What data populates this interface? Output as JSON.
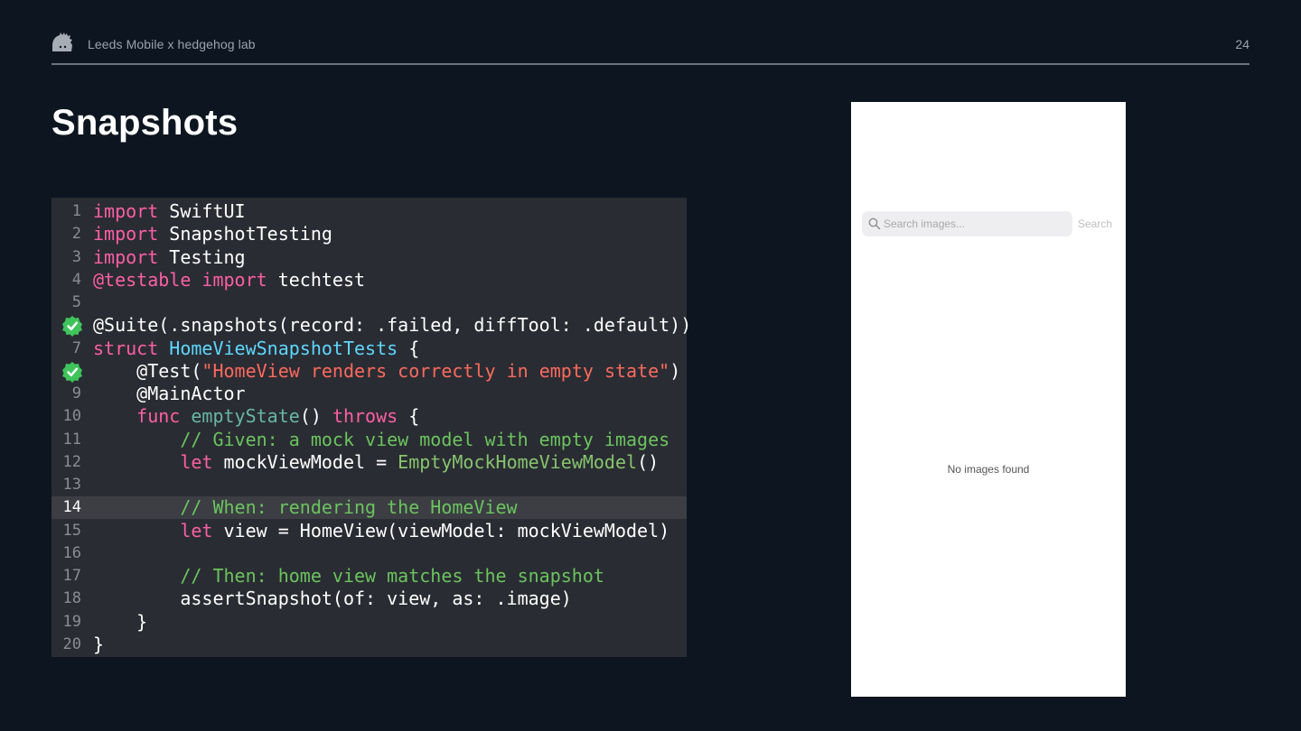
{
  "header": {
    "logo_icon": "hedgehog-icon",
    "text": "Leeds Mobile x hedgehog lab",
    "page_number": "24"
  },
  "slide": {
    "title": "Snapshots"
  },
  "code": {
    "active_line": 14,
    "badge_icon": "test-passed-checkmark-icon",
    "lines": [
      {
        "num": "1",
        "parts": [
          {
            "t": "import",
            "c": "kw"
          },
          {
            "t": " SwiftUI",
            "c": ""
          }
        ]
      },
      {
        "num": "2",
        "parts": [
          {
            "t": "import",
            "c": "kw"
          },
          {
            "t": " SnapshotTesting",
            "c": ""
          }
        ]
      },
      {
        "num": "3",
        "parts": [
          {
            "t": "import",
            "c": "kw"
          },
          {
            "t": " Testing",
            "c": ""
          }
        ]
      },
      {
        "num": "4",
        "parts": [
          {
            "t": "@testable",
            "c": "kw"
          },
          {
            "t": " ",
            "c": ""
          },
          {
            "t": "import",
            "c": "kw"
          },
          {
            "t": " techtest",
            "c": ""
          }
        ]
      },
      {
        "num": "5",
        "parts": []
      },
      {
        "num": "6",
        "badge": true,
        "parts": [
          {
            "t": "@Suite(.snapshots(record: .failed, diffTool: .default))",
            "c": ""
          }
        ]
      },
      {
        "num": "7",
        "parts": [
          {
            "t": "struct",
            "c": "kw"
          },
          {
            "t": " ",
            "c": ""
          },
          {
            "t": "HomeViewSnapshotTests",
            "c": "type"
          },
          {
            "t": " {",
            "c": ""
          }
        ]
      },
      {
        "num": "8",
        "badge": true,
        "parts": [
          {
            "t": "    @Test(",
            "c": ""
          },
          {
            "t": "\"HomeView renders correctly in empty state\"",
            "c": "str"
          },
          {
            "t": ")",
            "c": ""
          }
        ]
      },
      {
        "num": "9",
        "parts": [
          {
            "t": "    @MainActor",
            "c": ""
          }
        ]
      },
      {
        "num": "10",
        "parts": [
          {
            "t": "    ",
            "c": ""
          },
          {
            "t": "func",
            "c": "kw"
          },
          {
            "t": " ",
            "c": ""
          },
          {
            "t": "emptyState",
            "c": "fn"
          },
          {
            "t": "() ",
            "c": ""
          },
          {
            "t": "throws",
            "c": "kw"
          },
          {
            "t": " {",
            "c": ""
          }
        ]
      },
      {
        "num": "11",
        "parts": [
          {
            "t": "        ",
            "c": ""
          },
          {
            "t": "// Given: a mock view model with empty images",
            "c": "com"
          }
        ]
      },
      {
        "num": "12",
        "parts": [
          {
            "t": "        ",
            "c": ""
          },
          {
            "t": "let",
            "c": "kw"
          },
          {
            "t": " mockViewModel = ",
            "c": ""
          },
          {
            "t": "EmptyMockHomeViewModel",
            "c": "call"
          },
          {
            "t": "()",
            "c": ""
          }
        ]
      },
      {
        "num": "13",
        "parts": []
      },
      {
        "num": "14",
        "parts": [
          {
            "t": "        ",
            "c": ""
          },
          {
            "t": "// When: rendering the HomeView",
            "c": "com"
          }
        ]
      },
      {
        "num": "15",
        "parts": [
          {
            "t": "        ",
            "c": ""
          },
          {
            "t": "let",
            "c": "kw"
          },
          {
            "t": " view = HomeView(viewModel: mockViewModel)",
            "c": ""
          }
        ]
      },
      {
        "num": "16",
        "parts": []
      },
      {
        "num": "17",
        "parts": [
          {
            "t": "        ",
            "c": ""
          },
          {
            "t": "// Then: home view matches the snapshot",
            "c": "com"
          }
        ]
      },
      {
        "num": "18",
        "parts": [
          {
            "t": "        assertSnapshot(of: view, as: .image)",
            "c": ""
          }
        ]
      },
      {
        "num": "19",
        "parts": [
          {
            "t": "    }",
            "c": ""
          }
        ]
      },
      {
        "num": "20",
        "parts": [
          {
            "t": "}",
            "c": ""
          }
        ]
      }
    ]
  },
  "phone_preview": {
    "search_icon": "magnifier-icon",
    "search_placeholder": "Search images...",
    "search_button": "Search",
    "empty_message": "No images found"
  }
}
